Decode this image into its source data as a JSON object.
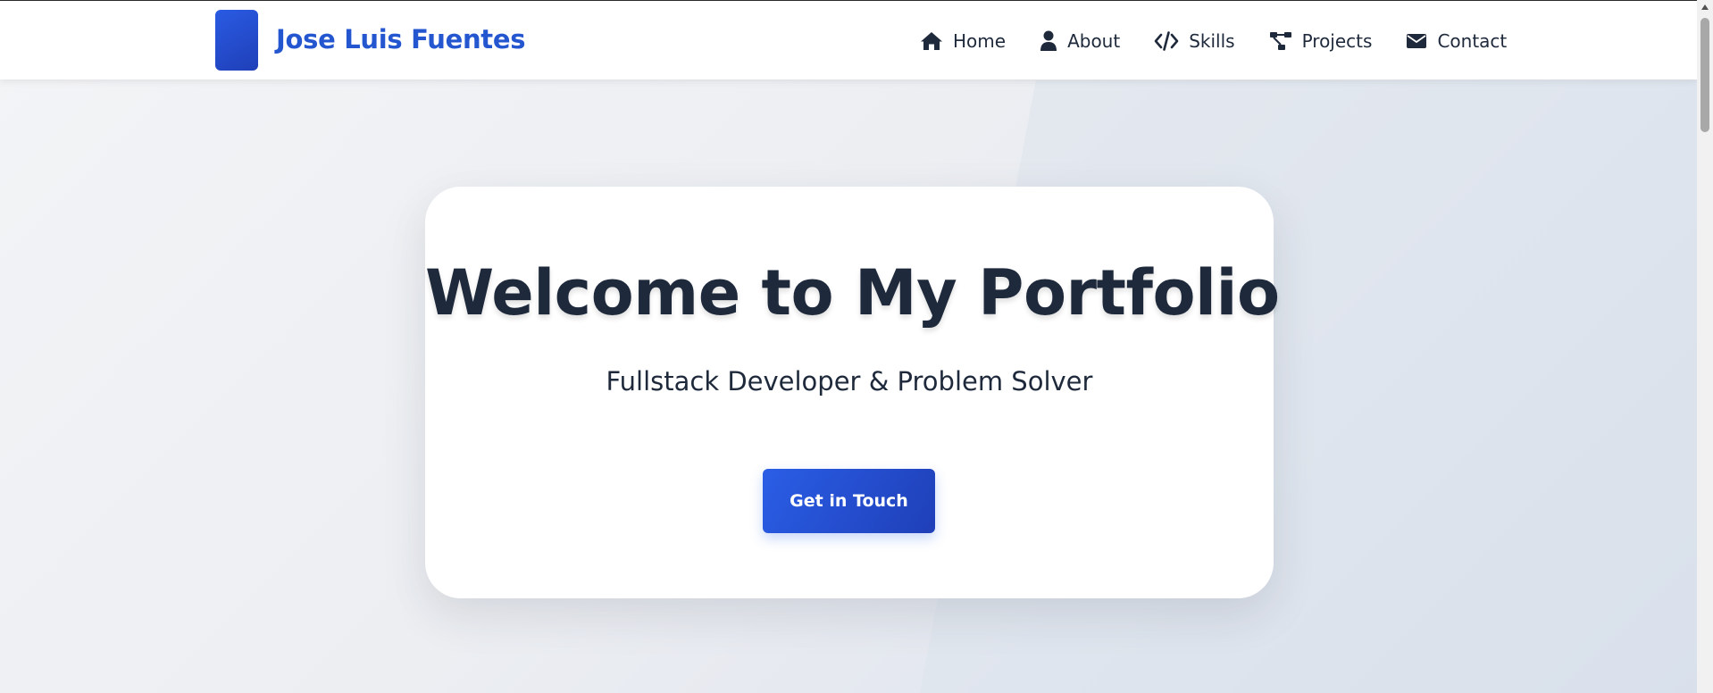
{
  "header": {
    "brand_name": "Jose Luis Fuentes",
    "nav": [
      {
        "label": "Home",
        "icon": "home-icon"
      },
      {
        "label": "About",
        "icon": "user-icon"
      },
      {
        "label": "Skills",
        "icon": "code-icon"
      },
      {
        "label": "Projects",
        "icon": "project-diagram-icon"
      },
      {
        "label": "Contact",
        "icon": "envelope-icon"
      }
    ]
  },
  "hero": {
    "title": "Welcome to My Portfolio",
    "subtitle": "Fullstack Developer & Problem Solver",
    "cta_label": "Get in Touch"
  },
  "colors": {
    "brand_blue": "#2456d0",
    "text_dark": "#1e293b",
    "button_gradient_start": "#2a5ee6",
    "button_gradient_end": "#1f3fb8"
  }
}
